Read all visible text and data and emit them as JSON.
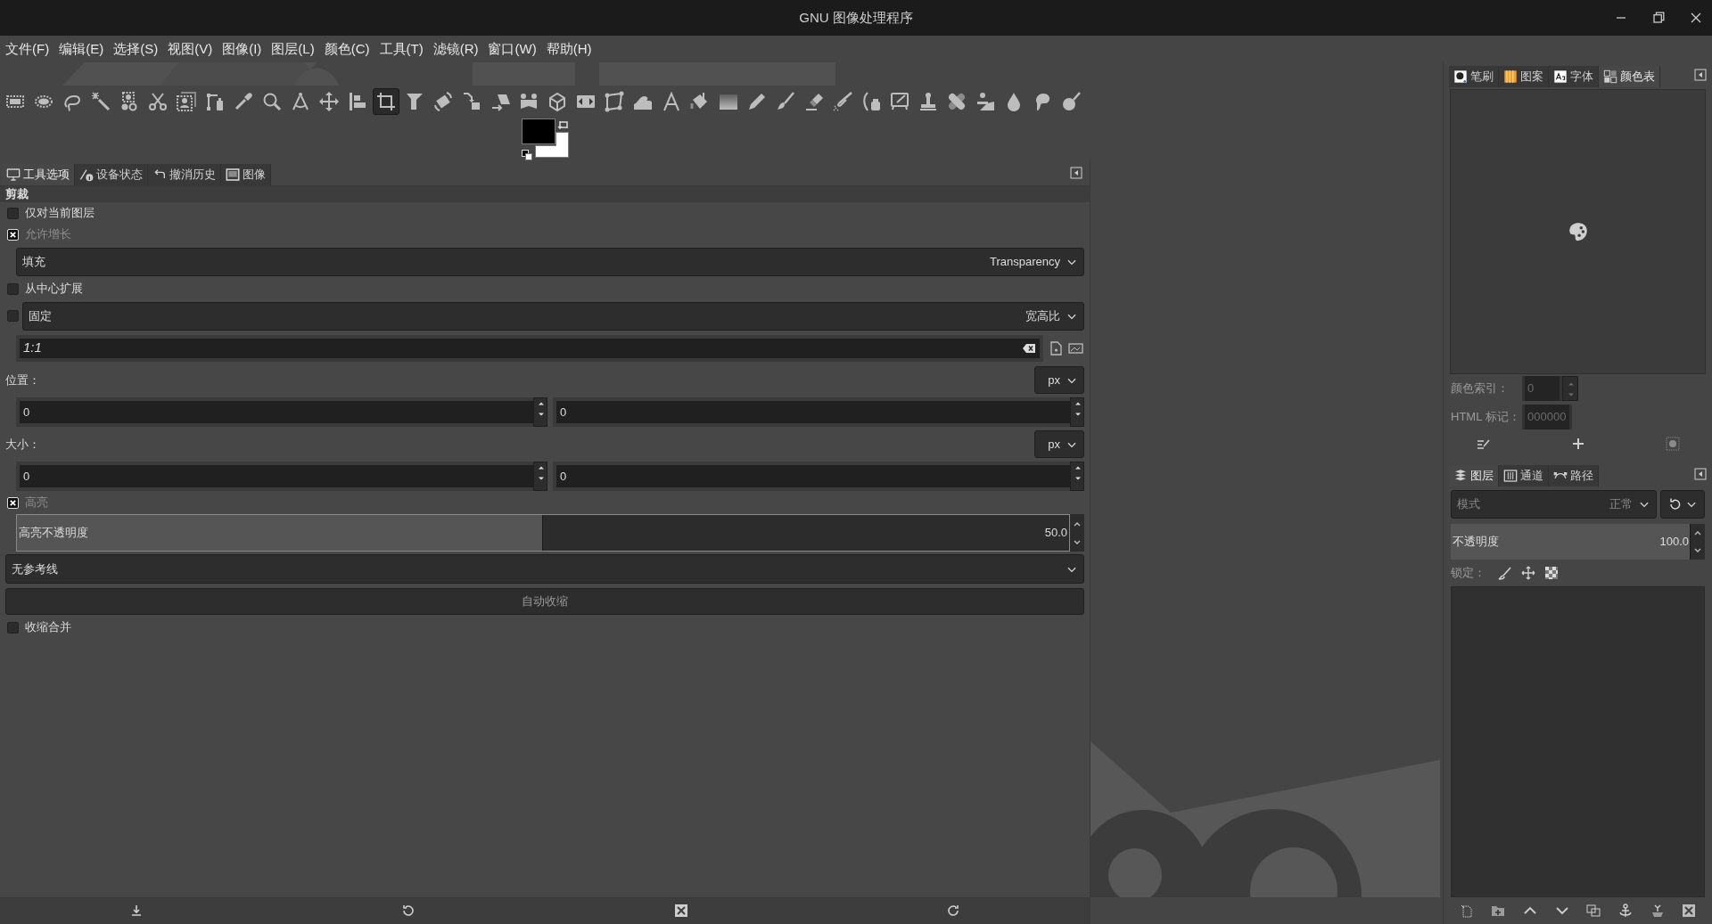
{
  "window": {
    "title": "GNU 图像处理程序"
  },
  "menu": [
    {
      "label": "文件(F)"
    },
    {
      "label": "编辑(E)"
    },
    {
      "label": "选择(S)"
    },
    {
      "label": "视图(V)"
    },
    {
      "label": "图像(I)"
    },
    {
      "label": "图层(L)"
    },
    {
      "label": "颜色(C)"
    },
    {
      "label": "工具(T)"
    },
    {
      "label": "滤镜(R)"
    },
    {
      "label": "窗口(W)"
    },
    {
      "label": "帮助(H)"
    }
  ],
  "toolbox": {
    "tools": [
      {
        "selected": false
      },
      {
        "selected": false
      },
      {
        "selected": false
      },
      {
        "selected": false
      },
      {
        "selected": false
      },
      {
        "selected": false
      },
      {
        "selected": false
      },
      {
        "selected": false
      },
      {
        "selected": false
      },
      {
        "selected": false
      },
      {
        "selected": false
      },
      {
        "selected": false
      },
      {
        "selected": false
      },
      {
        "selected": true
      },
      {
        "selected": false
      },
      {
        "selected": false
      },
      {
        "selected": false
      },
      {
        "selected": false
      },
      {
        "selected": false
      },
      {
        "selected": false
      },
      {
        "selected": false
      },
      {
        "selected": false
      },
      {
        "selected": false
      },
      {
        "selected": false
      },
      {
        "selected": false
      },
      {
        "selected": false
      },
      {
        "selected": false
      },
      {
        "selected": false
      },
      {
        "selected": false
      },
      {
        "selected": false
      },
      {
        "selected": false
      },
      {
        "selected": false
      },
      {
        "selected": false
      },
      {
        "selected": false
      },
      {
        "selected": false
      },
      {
        "selected": false
      },
      {
        "selected": false
      },
      {
        "selected": false
      }
    ],
    "swatches": [
      {
        "kind": "foreground",
        "color": "#000000"
      },
      {
        "kind": "background",
        "color": "#ffffff"
      }
    ]
  },
  "left_dock": {
    "tabs": [
      {
        "label": "工具选项",
        "selected": true
      },
      {
        "label": "设备状态",
        "selected": false
      },
      {
        "label": "撤消历史",
        "selected": false
      },
      {
        "label": "图像",
        "selected": false
      }
    ]
  },
  "tool_options": {
    "title": "剪裁",
    "options": [
      {
        "kind": "checkbox",
        "label": "仅对当前图层",
        "checked": false,
        "disabled": false
      },
      {
        "kind": "checkbox",
        "label": "允许增长",
        "checked": true,
        "disabled": true
      },
      {
        "kind": "field-dropdown",
        "label": "填充",
        "value": "Transparency"
      },
      {
        "kind": "checkbox",
        "label": "从中心扩展",
        "checked": false,
        "disabled": false
      },
      {
        "kind": "check-dropdown",
        "label": "固定",
        "value": "宽高比",
        "checked": false
      },
      {
        "kind": "entry",
        "value": "1:1"
      },
      {
        "kind": "unit-label",
        "label": "位置：",
        "unit": "px"
      },
      {
        "kind": "spin-pair",
        "values": [
          "0",
          "0"
        ]
      },
      {
        "kind": "unit-label",
        "label": "大小：",
        "unit": "px"
      },
      {
        "kind": "spin-pair",
        "values": [
          "0",
          "0"
        ]
      },
      {
        "kind": "checkbox",
        "label": "高亮",
        "checked": true,
        "disabled": true
      },
      {
        "kind": "slider",
        "label": "高亮不透明度",
        "value": "50.0",
        "level": 0.5
      },
      {
        "kind": "menu-dropdown",
        "value": "无参考线"
      },
      {
        "kind": "button",
        "label": "自动收缩"
      },
      {
        "kind": "checkbox",
        "label": "收缩合并",
        "checked": false,
        "disabled": false
      }
    ]
  },
  "upper_dock": {
    "tabs": [
      {
        "label": "笔刷",
        "selected": false
      },
      {
        "label": "图案",
        "selected": false
      },
      {
        "label": "字体",
        "selected": false
      },
      {
        "label": "颜色表",
        "selected": true
      }
    ],
    "color_index": {
      "label": "颜色索引：",
      "value": "0",
      "disabled": true
    },
    "html_notation": {
      "label": "HTML 标记：",
      "value": "000000",
      "disabled": true
    }
  },
  "lower_dock": {
    "tabs": [
      {
        "label": "图层",
        "selected": true
      },
      {
        "label": "通道",
        "selected": false
      },
      {
        "label": "路径",
        "selected": false
      }
    ],
    "mode": {
      "label": "模式",
      "value": "正常"
    },
    "opacity": {
      "label": "不透明度",
      "value": "100.0",
      "level": 1
    },
    "lock_label": "锁定："
  }
}
